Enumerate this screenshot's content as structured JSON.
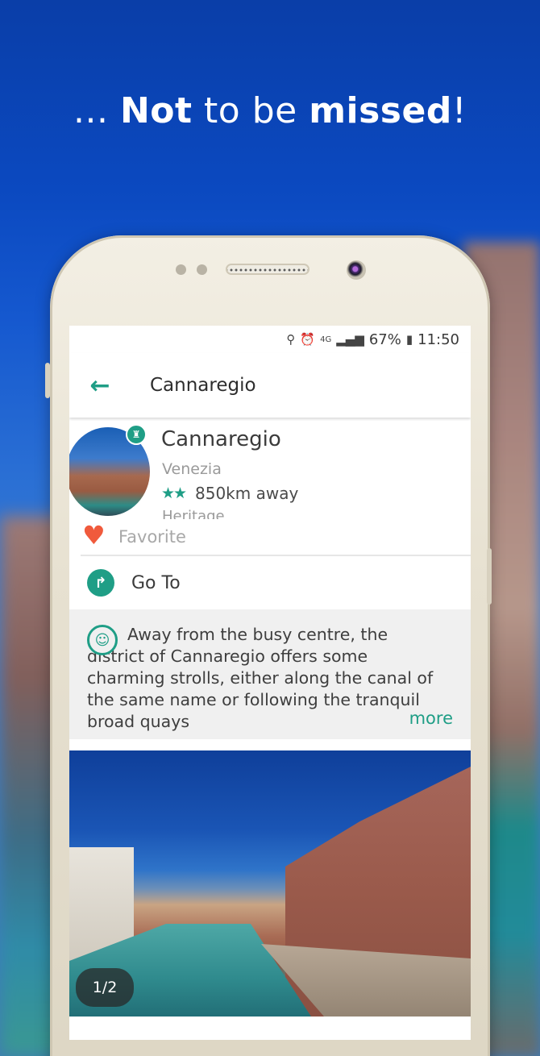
{
  "headline": {
    "prefix": "... ",
    "bold1": "Not",
    "middle": " to be ",
    "bold2": "missed",
    "suffix": "!"
  },
  "statusbar": {
    "icons": [
      "location-icon",
      "alarm-icon",
      "4g-icon",
      "signal-icon",
      "battery-icon"
    ],
    "network": "4G",
    "battery": "67%",
    "time": "11:50"
  },
  "appbar": {
    "title": "Cannaregio"
  },
  "place": {
    "name": "Cannaregio",
    "city": "Venezia",
    "stars": "★★",
    "distance": "850km away",
    "category": "Heritage"
  },
  "favorite": {
    "label": "Favorite"
  },
  "goto": {
    "label": "Go To"
  },
  "description": {
    "text": "Away from the busy centre, the district of Cannaregio offers some charming strolls, either along the canal of the same name or following the tranquil broad quays",
    "more": "more"
  },
  "gallery": {
    "counter": "1/2"
  },
  "colors": {
    "accent": "#1f9e86",
    "heart": "#f05a3c",
    "background": "#0b49c0"
  }
}
